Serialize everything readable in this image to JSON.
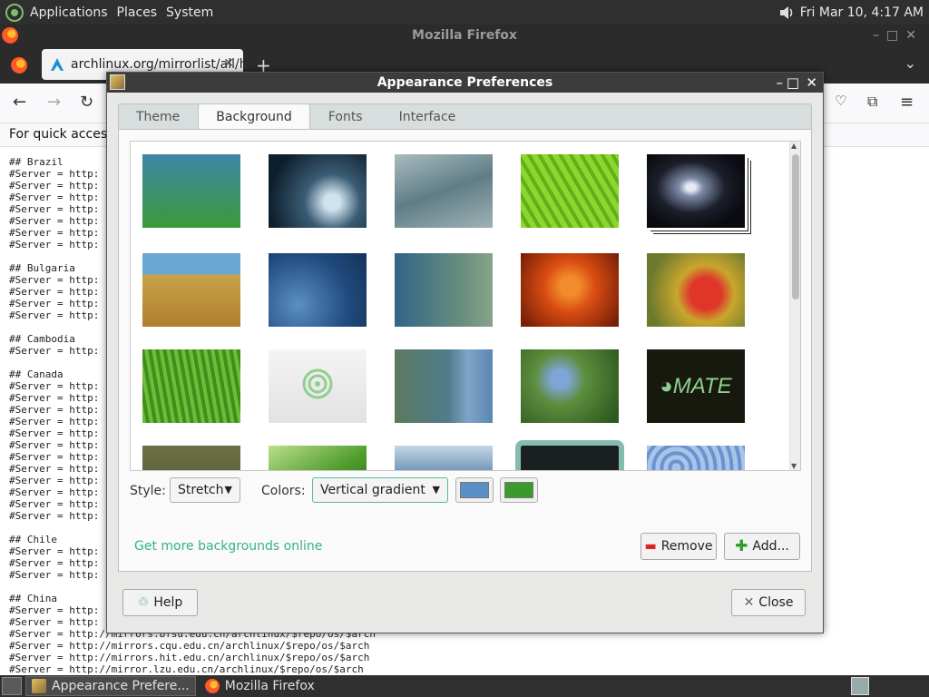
{
  "top_panel": {
    "menus": [
      "Applications",
      "Places",
      "System"
    ],
    "clock": "Fri Mar 10,  4:17 AM"
  },
  "firefox": {
    "window_title": "Mozilla Firefox",
    "tab_title": "archlinux.org/mirrorlist/all/ht",
    "bookmarks_text": "For quick access, p",
    "content_lines": [
      "## Brazil",
      "#Server = http:",
      "#Server = http:",
      "#Server = http:",
      "#Server = http:",
      "#Server = http:",
      "#Server = http:",
      "#Server = http:",
      "",
      "## Bulgaria",
      "#Server = http:",
      "#Server = http:",
      "#Server = http:",
      "#Server = http:",
      "",
      "## Cambodia",
      "#Server = http:",
      "",
      "## Canada",
      "#Server = http:",
      "#Server = http:",
      "#Server = http:",
      "#Server = http:",
      "#Server = http:",
      "#Server = http:",
      "#Server = http:",
      "#Server = http:",
      "#Server = http:",
      "#Server = http:",
      "#Server = http:",
      "#Server = http:",
      "",
      "## Chile",
      "#Server = http:",
      "#Server = http:",
      "#Server = http:",
      "",
      "## China",
      "#Server = http:",
      "#Server = http:",
      "#Server = http://mirrors.bfsu.edu.cn/archlinux/$repo/os/$arch",
      "#Server = http://mirrors.cqu.edu.cn/archlinux/$repo/os/$arch",
      "#Server = http://mirrors.hit.edu.cn/archlinux/$repo/os/$arch",
      "#Server = http://mirror.lzu.edu.cn/archlinux/$repo/os/$arch"
    ]
  },
  "dialog": {
    "title": "Appearance Preferences",
    "tabs": [
      "Theme",
      "Background",
      "Fonts",
      "Interface"
    ],
    "active_tab": "Background",
    "wallpapers": [
      {
        "name": "blue-green-gradient",
        "bg": "linear-gradient(#3d86a6,#3b9a3a)"
      },
      {
        "name": "water-drop",
        "bg": "radial-gradient(circle at 65% 65%, #cfe2ee 0 10%, #3a5c74 35%, #0d1e2c 80%)"
      },
      {
        "name": "teal-abstract",
        "bg": "linear-gradient(160deg,#a9bcc0,#5f7d86 50%,#9fb2b5)"
      },
      {
        "name": "green-leaf",
        "bg": "repeating-linear-gradient(60deg,#8fd62c 0 6px,#5fb01a 6px 10px)"
      },
      {
        "name": "galaxy",
        "bg": "radial-gradient(ellipse at 45% 45%, #e6eaf4 0 6%, #7c89a6 16%, #1b1f2b 45%, #0a0b10 75%)"
      },
      {
        "name": "grass-dune",
        "bg": "linear-gradient(#6aa7d3 0 28%, #c9a24a 30%, #b07e2e 100%)"
      },
      {
        "name": "blue-bubbles",
        "bg": "radial-gradient(circle at 30% 70%, #5b8fc2, #1f4a7d 60%, #153357)"
      },
      {
        "name": "blue-green-dots",
        "bg": "linear-gradient(90deg,#2f6587,#6b8f7d 70%,#87a48a)"
      },
      {
        "name": "orange-flower",
        "bg": "radial-gradient(circle at 50% 45%, #f28b2b 0 15%, #d94d12 40%, #7a2008 90%)"
      },
      {
        "name": "red-flower",
        "bg": "radial-gradient(circle at 60% 55%, #e0362a 0 22%, #c9a62d 40%, #6d7a2e 80%)"
      },
      {
        "name": "green-grass",
        "bg": "repeating-linear-gradient(80deg,#6fbd34 0 4px,#3f8f1e 4px 8px)"
      },
      {
        "name": "mate-logo-light",
        "bg": "linear-gradient(#f4f4f4,#e2e2e2)"
      },
      {
        "name": "green-blue-waves",
        "bg": "linear-gradient(90deg,#5c7a5e,#4f7c8d 55%,#7ea5c8 75%,#5a86b0)"
      },
      {
        "name": "bluebells",
        "bg": "radial-gradient(circle at 40% 40%, #7fa4d6 0 12%, #5d8d3d 35%, #2e5a20 90%)"
      },
      {
        "name": "mate-logo-dark",
        "bg": "#17190f"
      },
      {
        "name": "olive-texture",
        "bg": "linear-gradient(#6f7046,#4c5030)"
      },
      {
        "name": "green-leaves",
        "bg": "linear-gradient(150deg,#b9e08a,#4e9a2a 50%,#1f5a12)"
      },
      {
        "name": "blue-waves",
        "bg": "linear-gradient(#c5d6e6,#4e7ba6 50%,#9cb6cf)"
      },
      {
        "name": "solid-dark",
        "bg": "#1a1f1f"
      },
      {
        "name": "blue-texture",
        "bg": "repeating-radial-gradient(circle at 30% 30%, #a8c4e8 0 5px,#6c93cf 5px 9px)"
      }
    ],
    "mate_logo_text": "MATE",
    "style_label": "Style:",
    "style_value": "Stretch",
    "colors_label": "Colors:",
    "colors_value": "Vertical gradient",
    "color1": "#5b8fc7",
    "color2": "#3c9a2c",
    "more_link": "Get more backgrounds online",
    "remove_label": "Remove",
    "add_label": "Add...",
    "help_label": "Help",
    "close_label": "Close"
  },
  "taskbar": {
    "tasks": [
      "Appearance Prefere...",
      "Mozilla Firefox"
    ]
  }
}
